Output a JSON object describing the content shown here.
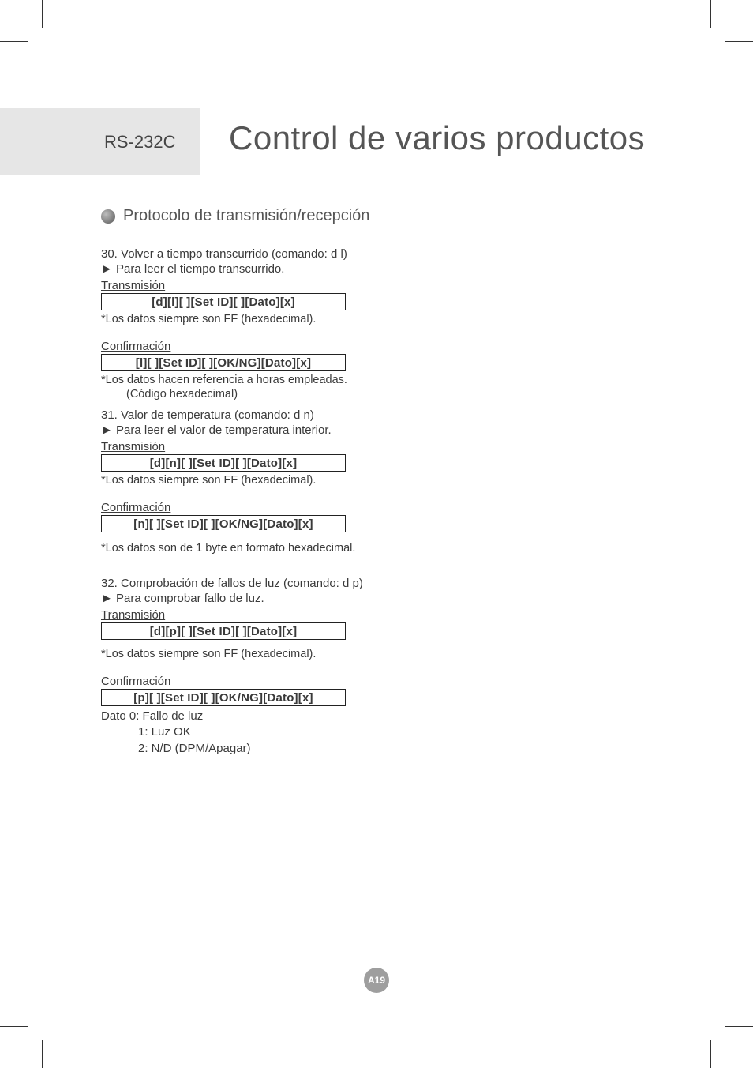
{
  "header": {
    "label": "RS-232C",
    "title": "Control de varios productos"
  },
  "section_title": "Protocolo de transmisión/recepción",
  "cmd30": {
    "title": "30. Volver a tiempo transcurrido (comando: d l)",
    "sub": "► Para leer el tiempo transcurrido.",
    "tx_label": "Transmisión",
    "tx_box": "[d][l][ ][Set ID][ ][Dato][x]",
    "tx_note": " *Los datos siempre son FF (hexadecimal).",
    "cf_label": "Confirmación",
    "cf_box": "[l][ ][Set ID][ ][OK/NG][Dato][x]",
    "cf_note1": " *Los datos hacen referencia a horas empleadas.",
    "cf_note2": "(Código hexadecimal)"
  },
  "cmd31": {
    "title": "31. Valor de temperatura (comando: d n)",
    "sub": "► Para leer el valor de temperatura interior.",
    "tx_label": "Transmisión",
    "tx_box": "[d][n][ ][Set ID][ ][Dato][x]",
    "tx_note": "*Los datos siempre son FF (hexadecimal).",
    "cf_label": "Confirmación",
    "cf_box": "[n][ ][Set ID][ ][OK/NG][Dato][x]",
    "cf_note": "*Los datos son de 1 byte en formato hexadecimal."
  },
  "cmd32": {
    "title": "32. Comprobación de fallos de luz (comando: d p)",
    "sub": "► Para comprobar fallo de luz.",
    "tx_label": "Transmisión",
    "tx_box": "[d][p][ ][Set ID][ ][Dato][x]",
    "tx_note": "*Los datos siempre son FF (hexadecimal).",
    "cf_label": "Confirmación",
    "cf_box": "[p][ ][Set ID][ ][OK/NG][Dato][x]",
    "dato_line1": "Dato 0: Fallo de luz",
    "dato_line2": "1: Luz OK",
    "dato_line3": "2: N/D (DPM/Apagar)"
  },
  "page_number": "A19"
}
